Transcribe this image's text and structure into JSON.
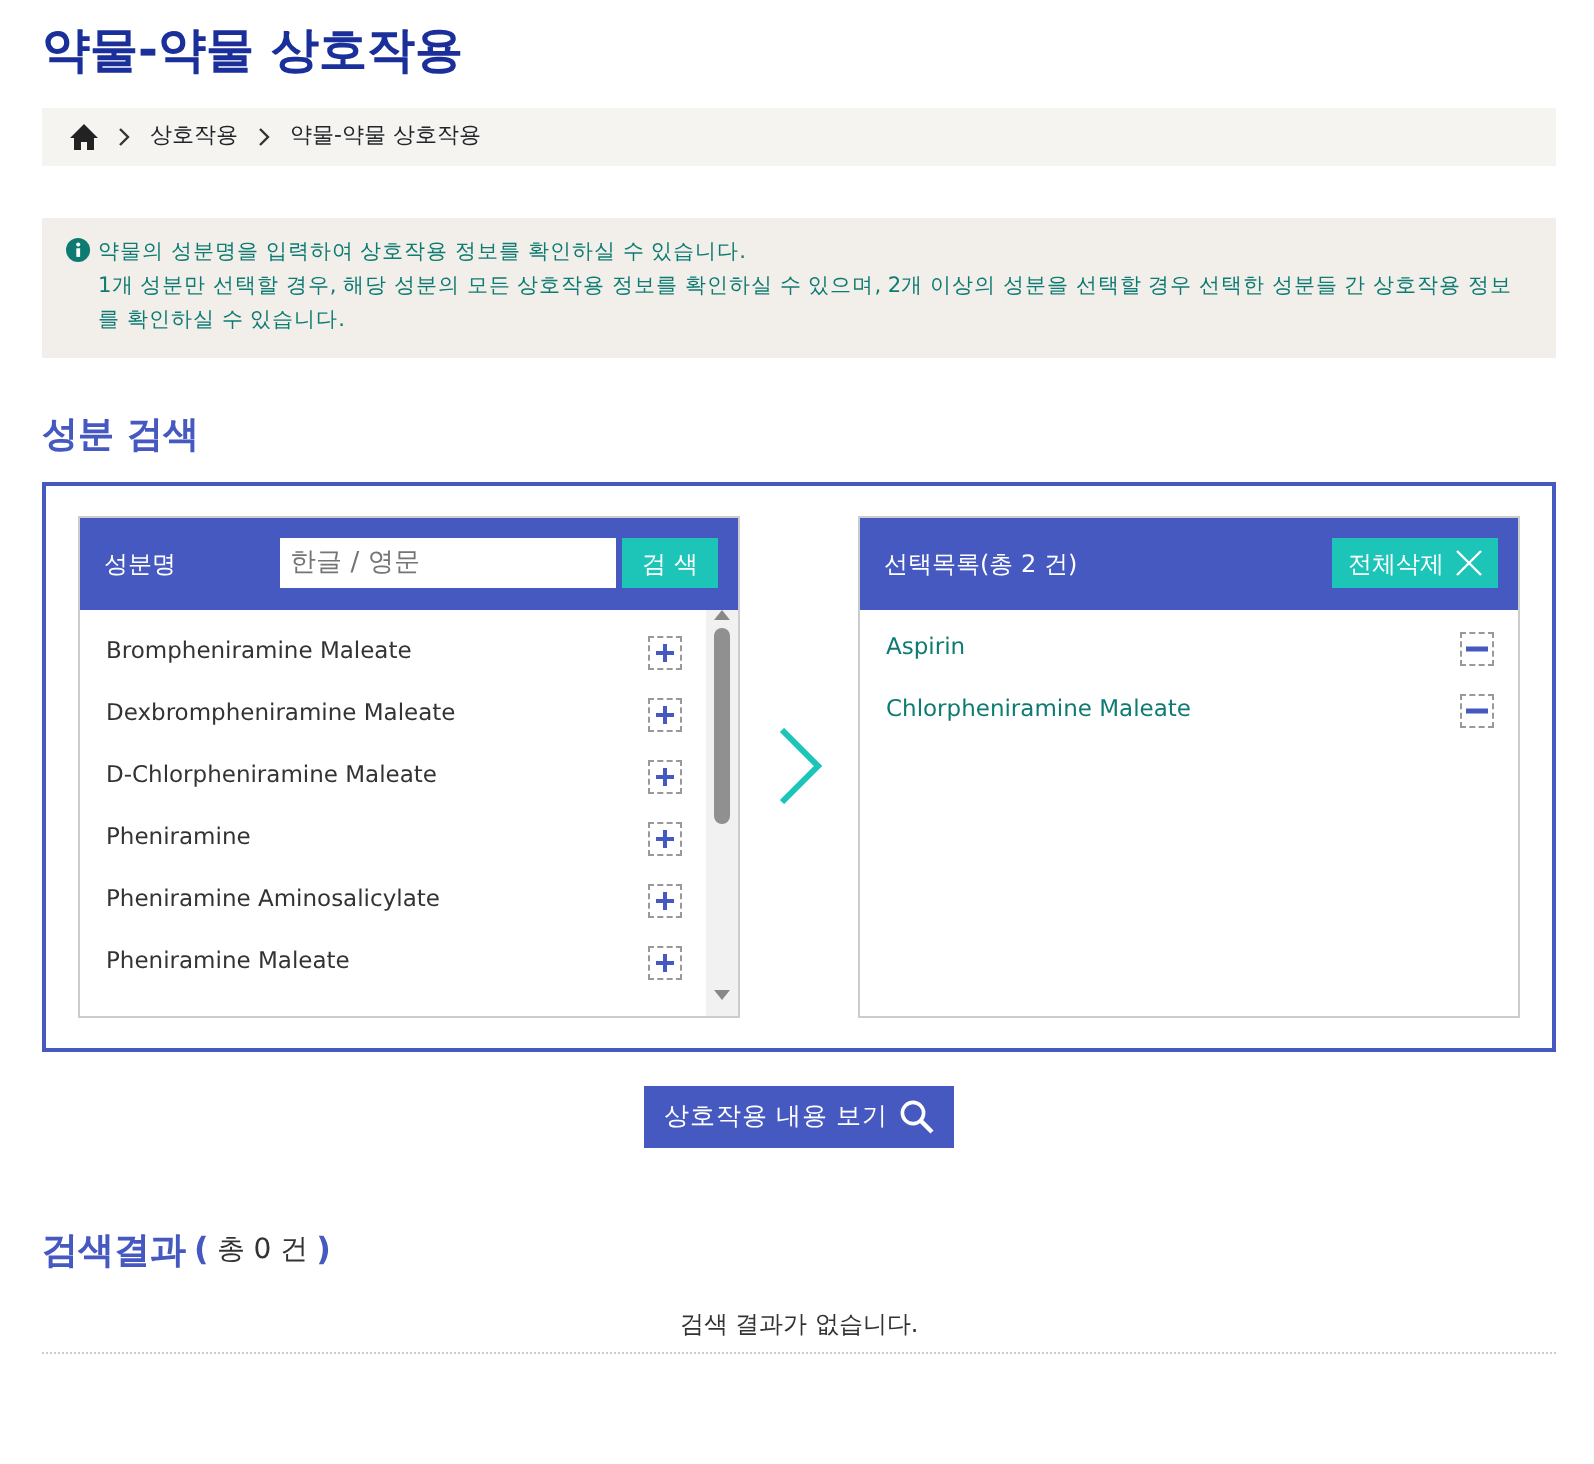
{
  "page_title": "약물-약물 상호작용",
  "breadcrumb": [
    "상호작용",
    "약물-약물 상호작용"
  ],
  "info": {
    "line_1": "약물의 성분명을 입력하여 상호작용 정보를 확인하실 수 있습니다.",
    "line_2": "1개 성분만 선택할 경우, 해당 성분의 모든 상호작용 정보를 확인하실 수 있으며, 2개 이상의 성분을 선택할 경우 선택한 성분들 간 상호작용 정보를 확인하실 수 있습니다."
  },
  "search_section": {
    "heading": "성분 검색",
    "search_panel": {
      "label": "성분명",
      "placeholder": "한글 / 영문",
      "search_button": "검 색",
      "results": [
        {
          "name": "Brompheniramine Maleate"
        },
        {
          "name": "Dexbrompheniramine Maleate"
        },
        {
          "name": "D-Chlorpheniramine Maleate"
        },
        {
          "name": "Pheniramine"
        },
        {
          "name": "Pheniramine Aminosalicylate"
        },
        {
          "name": "Pheniramine Maleate"
        }
      ]
    },
    "selected_panel": {
      "title": "선택목록(총 2 건)",
      "clear_button": "전체삭제",
      "items": [
        {
          "name": "Aspirin"
        },
        {
          "name": "Chlorpheniramine Maleate"
        }
      ]
    }
  },
  "view_button": "상호작용 내용 보기",
  "results": {
    "heading": "검색결과",
    "paren_open": "(",
    "count": "총 0 건",
    "paren_close": ")",
    "empty_message": "검색 결과가 없습니다."
  }
}
